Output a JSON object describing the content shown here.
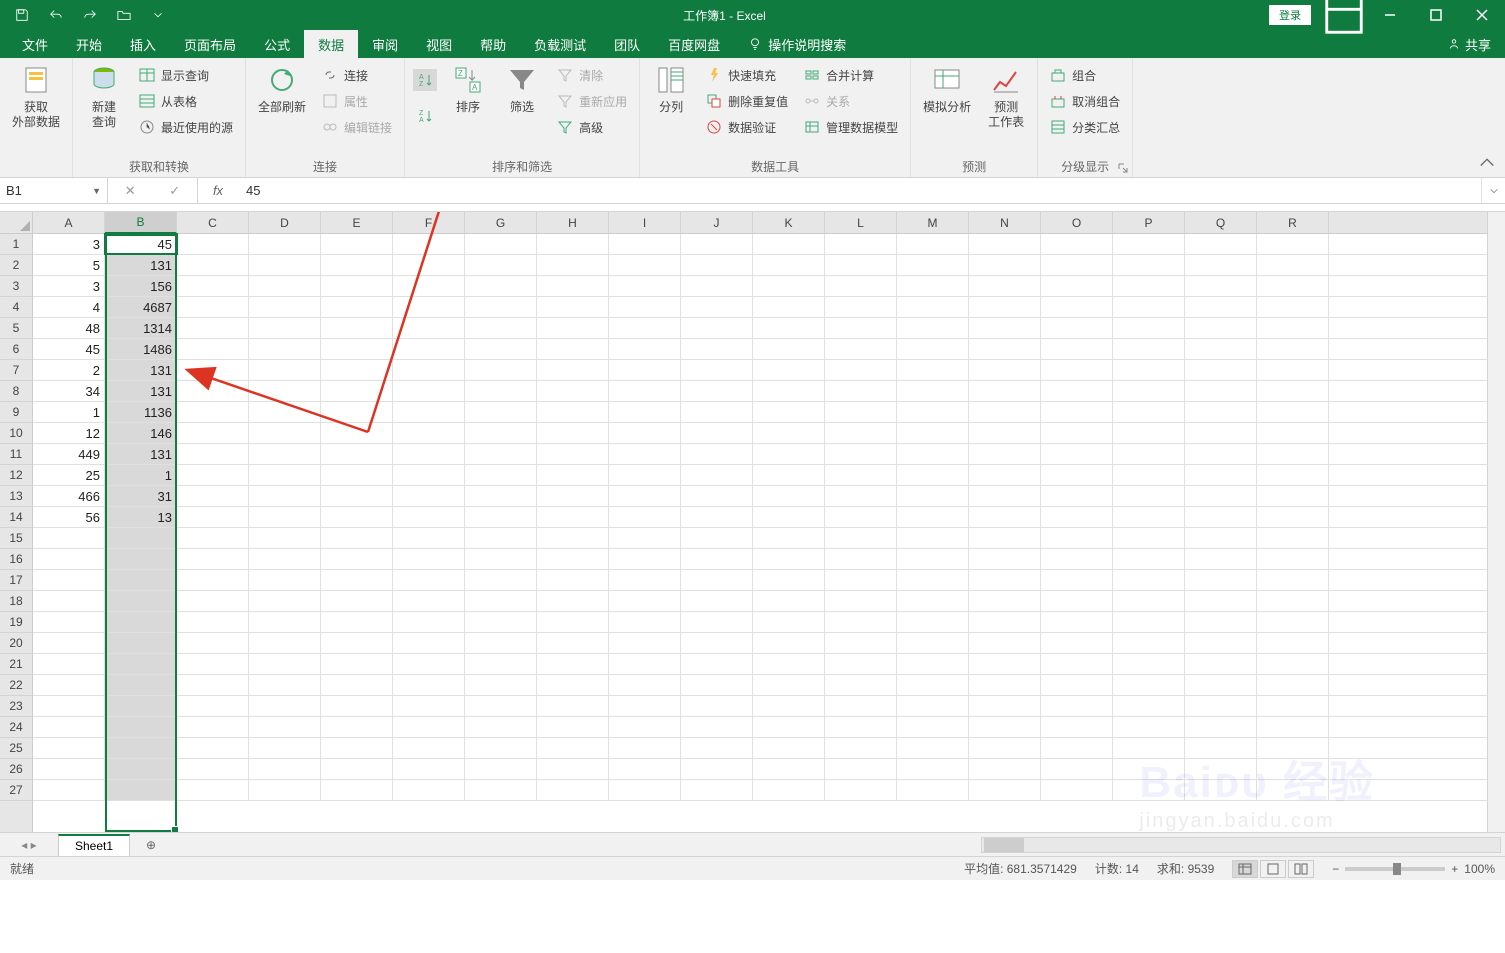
{
  "titlebar": {
    "title": "工作簿1 - Excel",
    "login": "登录"
  },
  "tabs": {
    "file": "文件",
    "home": "开始",
    "insert": "插入",
    "layout": "页面布局",
    "formulas": "公式",
    "data": "数据",
    "review": "审阅",
    "view": "视图",
    "help": "帮助",
    "loadtest": "负载测试",
    "team": "团队",
    "baidu": "百度网盘",
    "tellme": "操作说明搜索",
    "share": "共享"
  },
  "ribbon": {
    "get_external": "获取\n外部数据",
    "new_query": "新建\n查询",
    "show_query": "显示查询",
    "from_table": "从表格",
    "recent_sources": "最近使用的源",
    "group_get": "获取和转换",
    "refresh_all": "全部刷新",
    "connections": "连接",
    "properties": "属性",
    "edit_links": "编辑链接",
    "group_conn": "连接",
    "sort": "排序",
    "filter": "筛选",
    "clear": "清除",
    "reapply": "重新应用",
    "advanced": "高级",
    "group_sortfilter": "排序和筛选",
    "text_to_col": "分列",
    "flash_fill": "快速填充",
    "remove_dup": "删除重复值",
    "data_valid": "数据验证",
    "consolidate": "合并计算",
    "relationships": "关系",
    "manage_model": "管理数据模型",
    "group_datatools": "数据工具",
    "whatif": "模拟分析",
    "forecast": "预测\n工作表",
    "group_forecast": "预测",
    "group_btn": "组合",
    "ungroup": "取消组合",
    "subtotal": "分类汇总",
    "group_outline": "分级显示"
  },
  "formula": {
    "name_box": "B1",
    "value": "45",
    "fx": "fx"
  },
  "columns": [
    "A",
    "B",
    "C",
    "D",
    "E",
    "F",
    "G",
    "H",
    "I",
    "J",
    "K",
    "L",
    "M",
    "N",
    "O",
    "P",
    "Q",
    "R"
  ],
  "rows": [
    1,
    2,
    3,
    4,
    5,
    6,
    7,
    8,
    9,
    10,
    11,
    12,
    13,
    14,
    15,
    16,
    17,
    18,
    19,
    20,
    21,
    22,
    23,
    24,
    25,
    26,
    27
  ],
  "data": {
    "A": [
      "3",
      "5",
      "3",
      "4",
      "48",
      "45",
      "2",
      "34",
      "1",
      "12",
      "449",
      "25",
      "466",
      "56"
    ],
    "B": [
      "45",
      "131",
      "156",
      "4687",
      "1314",
      "1486",
      "131",
      "131",
      "1136",
      "146",
      "131",
      "1",
      "31",
      "13"
    ]
  },
  "sheets": {
    "active": "Sheet1"
  },
  "status": {
    "ready": "就绪",
    "avg_label": "平均值:",
    "avg": "681.3571429",
    "count_label": "计数:",
    "count": "14",
    "sum_label": "求和:",
    "sum": "9539",
    "zoom": "100%"
  }
}
